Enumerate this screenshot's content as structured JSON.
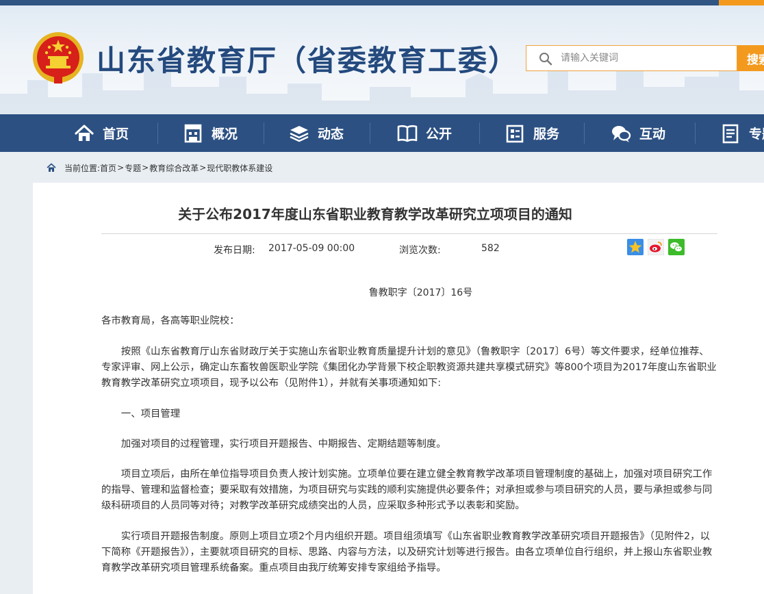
{
  "header": {
    "site_title": "山东省教育厅（省委教育工委）",
    "search_placeholder": "请输入关键词",
    "search_button": "搜索",
    "colors": {
      "nav_bg": "#2c5082",
      "accent": "#f39a1e",
      "title": "#244a7e"
    }
  },
  "nav": {
    "items": [
      {
        "label": "首页",
        "icon": "home-icon"
      },
      {
        "label": "概况",
        "icon": "building-icon"
      },
      {
        "label": "动态",
        "icon": "layers-icon"
      },
      {
        "label": "公开",
        "icon": "book-icon"
      },
      {
        "label": "服务",
        "icon": "clipboard-icon"
      },
      {
        "label": "互动",
        "icon": "chat-icon"
      },
      {
        "label": "专题",
        "icon": "document-icon"
      }
    ]
  },
  "breadcrumb": {
    "prefix": "当前位置:",
    "items": [
      "首页",
      "专题",
      "教育综合改革",
      "现代职教体系建设"
    ],
    "separator": ">"
  },
  "article": {
    "title": "关于公布2017年度山东省职业教育教学改革研究立项项目的通知",
    "date_label": "发布日期:",
    "date_value": "2017-05-09 00:00",
    "views_label": "浏览次数:",
    "views_value": "582",
    "share_icons": [
      "qzone-icon",
      "weibo-icon",
      "wechat-icon"
    ],
    "doc_number": "鲁教职字〔2017〕16号",
    "recipients": "各市教育局，各高等职业院校：",
    "paragraphs": [
      "按照《山东省教育厅山东省财政厅关于实施山东省职业教育质量提升计划的意见》（鲁教职字〔2017〕6号）等文件要求，经单位推荐、专家评审、网上公示，确定山东畜牧兽医职业学院《集团化办学背景下校企职教资源共建共享模式研究》等800个项目为2017年度山东省职业教育教学改革研究立项项目，现予以公布（见附件1），并就有关事项通知如下:",
      "一、项目管理",
      "加强对项目的过程管理，实行项目开题报告、中期报告、定期结题等制度。",
      "项目立项后，由所在单位指导项目负责人按计划实施。立项单位要在建立健全教育教学改革项目管理制度的基础上，加强对项目研究工作的指导、管理和监督检查；要采取有效措施，为项目研究与实践的顺利实施提供必要条件；对承担或参与项目研究的人员，要与承担或参与同级科研项目的人员同等对待；对教学改革研究成绩突出的人员，应采取多种形式予以表彰和奖励。",
      "实行项目开题报告制度。原则上项目立项2个月内组织开题。项目组须填写《山东省职业教育教学改革研究项目开题报告》（见附件2，以下简称《开题报告》），主要就项目研究的目标、思路、内容与方法，以及研究计划等进行报告。由各立项单位自行组织，并上报山东省职业教育教学改革研究项目管理系统备案。重点项目由我厅统筹安排专家组给予指导。"
    ]
  }
}
